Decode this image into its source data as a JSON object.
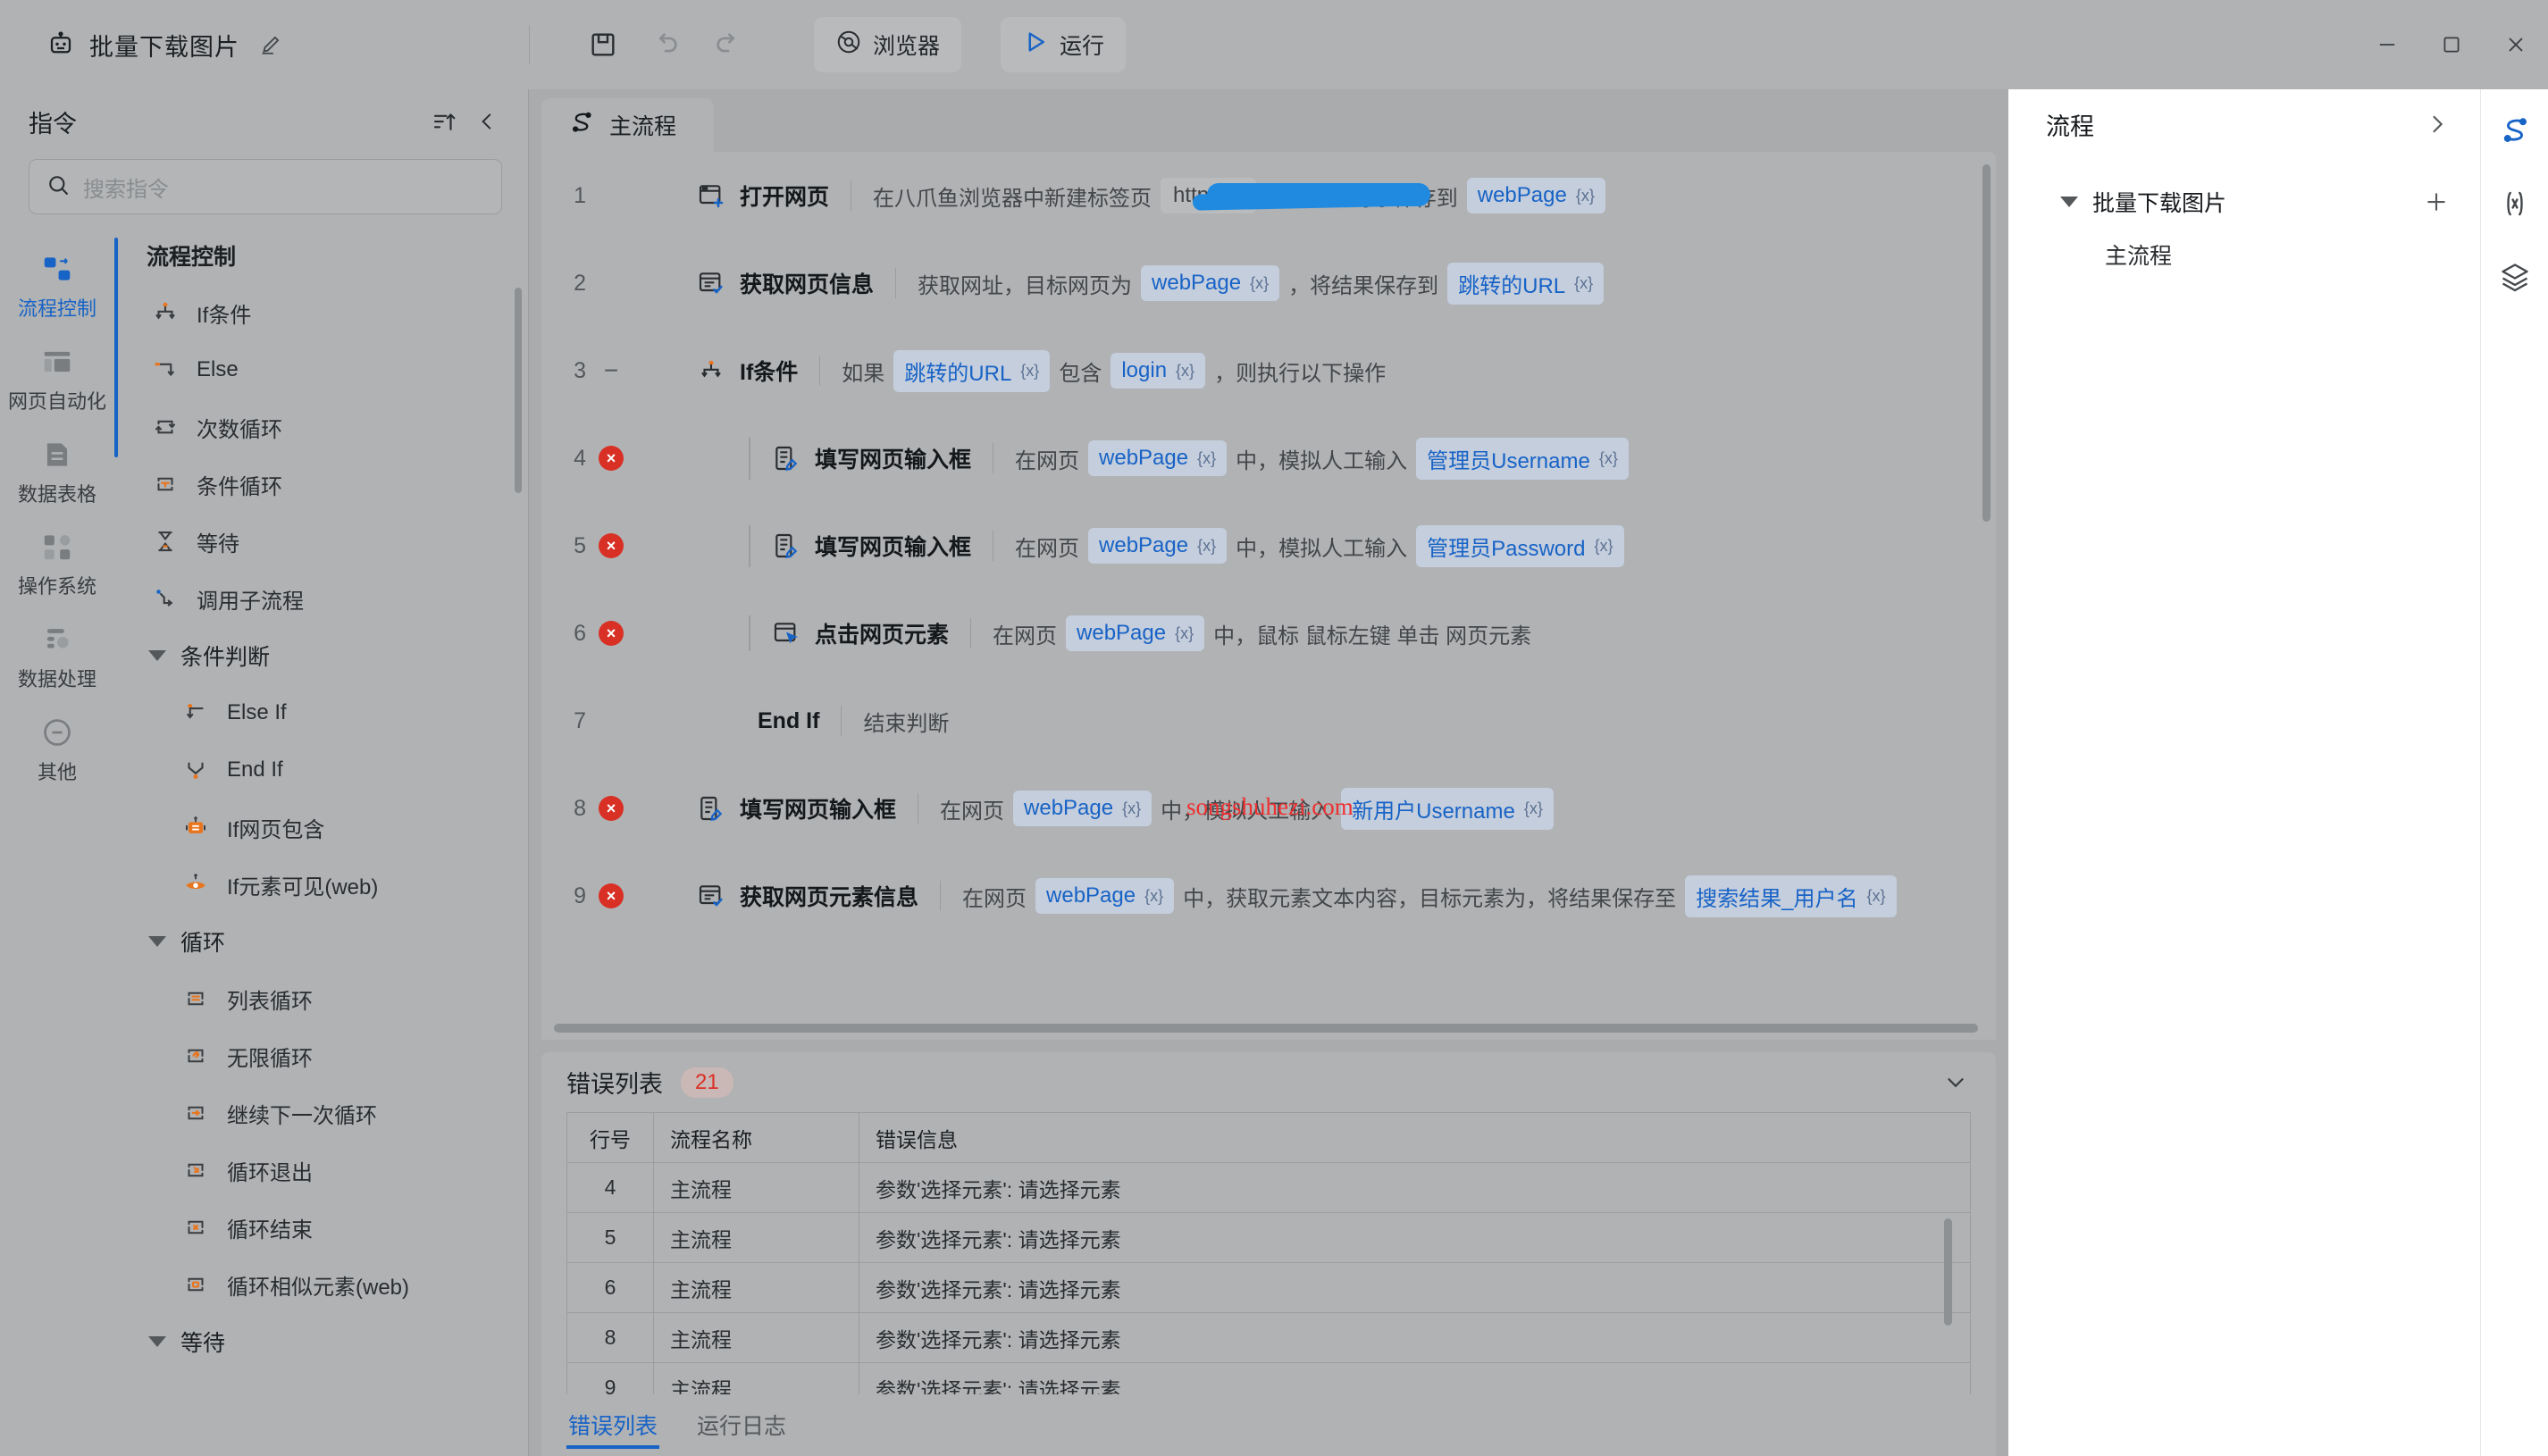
{
  "titlebar": {
    "robot_icon": "robot-icon",
    "app_title": "批量下载图片",
    "edit_icon": "pencil-icon",
    "toolbar": {
      "save_icon": "save-icon",
      "undo_icon": "undo-icon",
      "redo_icon": "redo-icon",
      "browser_label": "浏览器",
      "browser_icon": "browser-icon",
      "run_label": "运行",
      "run_icon": "play-icon"
    },
    "window": {
      "minimize": "minimize-icon",
      "maximize": "maximize-icon",
      "close": "close-icon"
    }
  },
  "left_panel": {
    "title": "指令",
    "sort_icon": "sort-icon",
    "collapse_icon": "chevron-left-icon",
    "search": {
      "placeholder": "搜索指令",
      "icon": "search-icon"
    },
    "categories": [
      {
        "label": "流程控制",
        "icon": "flow-control-icon",
        "active": true
      },
      {
        "label": "网页自动化",
        "icon": "web-automation-icon",
        "active": false
      },
      {
        "label": "数据表格",
        "icon": "data-table-icon",
        "active": false
      },
      {
        "label": "操作系统",
        "icon": "operating-system-icon",
        "active": false
      },
      {
        "label": "数据处理",
        "icon": "data-processing-icon",
        "active": false
      },
      {
        "label": "其他",
        "icon": "other-icon",
        "active": false
      }
    ],
    "group_title": "流程控制",
    "commands": [
      {
        "label": "If条件",
        "icon": "if-condition-icon",
        "type": "item"
      },
      {
        "label": "Else",
        "icon": "else-icon",
        "type": "item"
      },
      {
        "label": "次数循环",
        "icon": "count-loop-icon",
        "type": "item"
      },
      {
        "label": "条件循环",
        "icon": "condition-loop-icon",
        "type": "item"
      },
      {
        "label": "等待",
        "icon": "wait-icon",
        "type": "item"
      },
      {
        "label": "调用子流程",
        "icon": "call-subflow-icon",
        "type": "item"
      },
      {
        "label": "条件判断",
        "icon": "triangle-down-icon",
        "type": "group"
      },
      {
        "label": "Else If",
        "icon": "else-if-icon",
        "type": "child"
      },
      {
        "label": "End If",
        "icon": "end-if-icon",
        "type": "child"
      },
      {
        "label": "If网页包含",
        "icon": "if-page-contains-icon",
        "type": "child"
      },
      {
        "label": "If元素可见(web)",
        "icon": "if-element-visible-icon",
        "type": "child"
      },
      {
        "label": "循环",
        "icon": "triangle-down-icon",
        "type": "group"
      },
      {
        "label": "列表循环",
        "icon": "list-loop-icon",
        "type": "child"
      },
      {
        "label": "无限循环",
        "icon": "infinite-loop-icon",
        "type": "child"
      },
      {
        "label": "继续下一次循环",
        "icon": "continue-loop-icon",
        "type": "child"
      },
      {
        "label": "循环退出",
        "icon": "break-loop-icon",
        "type": "child"
      },
      {
        "label": "循环结束",
        "icon": "end-loop-icon",
        "type": "child"
      },
      {
        "label": "循环相似元素(web)",
        "icon": "loop-similar-elements-icon",
        "type": "child"
      },
      {
        "label": "等待",
        "icon": "triangle-down-icon",
        "type": "group"
      }
    ]
  },
  "center": {
    "tab": {
      "label": "主流程",
      "icon": "flow-tab-icon"
    },
    "watermark": "songshuhezi.com",
    "steps": [
      {
        "num": "1",
        "status": "",
        "indent": 0,
        "icon": "open-webpage-icon",
        "name": "打开网页",
        "parts": [
          {
            "kind": "text",
            "text": "在八爪鱼浏览器中新建标签页"
          },
          {
            "kind": "url",
            "text": "http://gi"
          },
          {
            "kind": "text",
            "text": "，将网页对象保存到"
          },
          {
            "kind": "var",
            "text": "webPage"
          }
        ]
      },
      {
        "num": "2",
        "status": "",
        "indent": 0,
        "icon": "get-webpage-info-icon",
        "name": "获取网页信息",
        "parts": [
          {
            "kind": "text",
            "text": "获取网址，目标网页为"
          },
          {
            "kind": "var",
            "text": "webPage"
          },
          {
            "kind": "text",
            "text": "，将结果保存到"
          },
          {
            "kind": "var",
            "text": "跳转的URL"
          }
        ]
      },
      {
        "num": "3",
        "status": "collapse",
        "indent": 0,
        "icon": "if-condition-icon",
        "name": "If条件",
        "parts": [
          {
            "kind": "text",
            "text": "如果"
          },
          {
            "kind": "var",
            "text": "跳转的URL"
          },
          {
            "kind": "text",
            "text": "包含"
          },
          {
            "kind": "var",
            "text": "login"
          },
          {
            "kind": "text",
            "text": "，则执行以下操作"
          }
        ]
      },
      {
        "num": "4",
        "status": "error",
        "indent": 1,
        "icon": "fill-input-icon",
        "name": "填写网页输入框",
        "parts": [
          {
            "kind": "text",
            "text": "在网页"
          },
          {
            "kind": "var",
            "text": "webPage"
          },
          {
            "kind": "text",
            "text": "中，模拟人工输入"
          },
          {
            "kind": "var",
            "text": "管理员Username"
          }
        ]
      },
      {
        "num": "5",
        "status": "error",
        "indent": 1,
        "icon": "fill-input-icon",
        "name": "填写网页输入框",
        "parts": [
          {
            "kind": "text",
            "text": "在网页"
          },
          {
            "kind": "var",
            "text": "webPage"
          },
          {
            "kind": "text",
            "text": "中，模拟人工输入"
          },
          {
            "kind": "var",
            "text": "管理员Password"
          }
        ]
      },
      {
        "num": "6",
        "status": "error",
        "indent": 1,
        "icon": "click-element-icon",
        "name": "点击网页元素",
        "parts": [
          {
            "kind": "text",
            "text": "在网页"
          },
          {
            "kind": "var",
            "text": "webPage"
          },
          {
            "kind": "text",
            "text": "中，鼠标 鼠标左键 单击 网页元素"
          }
        ]
      },
      {
        "num": "7",
        "status": "",
        "indent": 0,
        "endif": true,
        "icon": "",
        "name": "End If",
        "parts": [
          {
            "kind": "text",
            "text": "结束判断"
          }
        ]
      },
      {
        "num": "8",
        "status": "error",
        "indent": 0,
        "icon": "fill-input-icon",
        "name": "填写网页输入框",
        "parts": [
          {
            "kind": "text",
            "text": "在网页"
          },
          {
            "kind": "var",
            "text": "webPage"
          },
          {
            "kind": "text",
            "text": "中，模拟人工输入"
          },
          {
            "kind": "var",
            "text": "新用户Username"
          }
        ]
      },
      {
        "num": "9",
        "status": "error",
        "indent": 0,
        "icon": "get-element-info-icon",
        "name": "获取网页元素信息",
        "parts": [
          {
            "kind": "text",
            "text": "在网页"
          },
          {
            "kind": "var",
            "text": "webPage"
          },
          {
            "kind": "text",
            "text": "中，获取元素文本内容，目标元素为，将结果保存至"
          },
          {
            "kind": "var",
            "text": "搜索结果_用户名"
          }
        ]
      }
    ]
  },
  "bottom_panel": {
    "title": "错误列表",
    "count": "21",
    "collapse_icon": "chevron-down-icon",
    "columns": [
      "行号",
      "流程名称",
      "错误信息"
    ],
    "rows": [
      {
        "line": "4",
        "flow": "主流程",
        "message": "参数'选择元素': 请选择元素"
      },
      {
        "line": "5",
        "flow": "主流程",
        "message": "参数'选择元素': 请选择元素"
      },
      {
        "line": "6",
        "flow": "主流程",
        "message": "参数'选择元素': 请选择元素"
      },
      {
        "line": "8",
        "flow": "主流程",
        "message": "参数'选择元素': 请选择元素"
      },
      {
        "line": "9",
        "flow": "主流程",
        "message": "参数'选择元素': 请选择元素"
      }
    ],
    "tabs": [
      {
        "label": "错误列表",
        "active": true
      },
      {
        "label": "运行日志",
        "active": false
      }
    ]
  },
  "right_panel": {
    "title": "流程",
    "expand_icon": "chevron-right-icon",
    "tree": {
      "root_label": "批量下载图片",
      "add_icon": "plus-icon",
      "toggle_icon": "triangle-down-icon",
      "children": [
        {
          "label": "主流程"
        }
      ]
    },
    "rail": [
      {
        "icon": "flow-icon",
        "active": true
      },
      {
        "icon": "variables-icon",
        "active": false
      },
      {
        "icon": "layers-icon",
        "active": false
      }
    ]
  },
  "colors": {
    "accent": "#1763c6",
    "error": "#d93025",
    "chip_bg": "#c5cedd",
    "watermark": "#ef2f2f",
    "panel": "#b0b2b4"
  }
}
